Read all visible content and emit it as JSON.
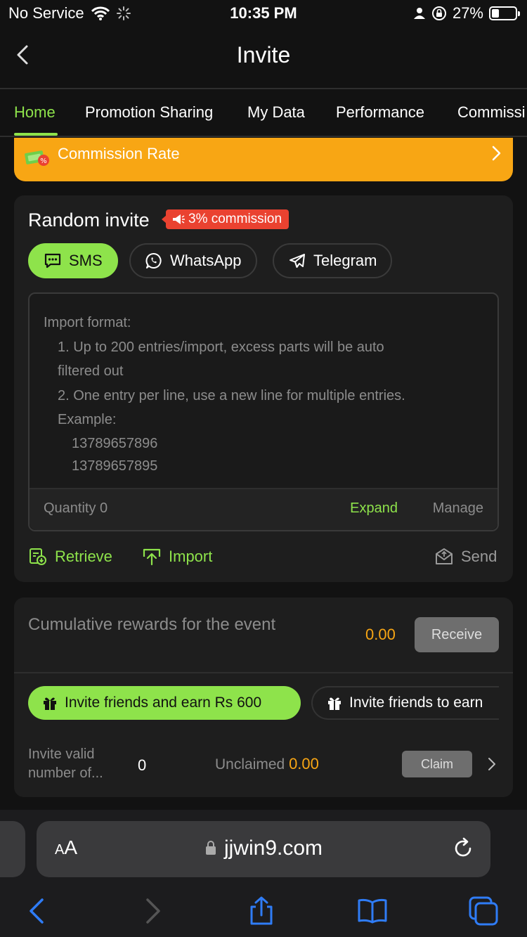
{
  "status_bar": {
    "carrier": "No Service",
    "time": "10:35 PM",
    "battery": "27%",
    "battery_level": 0.27
  },
  "header": {
    "title": "Invite"
  },
  "tabs": [
    {
      "label": "Home",
      "active": true
    },
    {
      "label": "Promotion Sharing"
    },
    {
      "label": "My Data"
    },
    {
      "label": "Performance"
    },
    {
      "label": "Commissi"
    }
  ],
  "commission_banner": {
    "label": "Commission Rate"
  },
  "invite_card": {
    "title": "Random invite",
    "badge": "3% commission",
    "channels": [
      {
        "label": "SMS",
        "icon": "sms-icon",
        "active": true
      },
      {
        "label": "WhatsApp",
        "icon": "whatsapp-icon"
      },
      {
        "label": "Telegram",
        "icon": "telegram-icon"
      }
    ],
    "import_format": {
      "heading": "Import format:",
      "line1": "1. Up to 200 entries/import, excess parts will be auto",
      "line1b": "filtered out",
      "line2": "2. One entry per line, use a new line for multiple entries.",
      "example_label": "Example:",
      "example1": "13789657896",
      "example2": "13789657895"
    },
    "quantity": "Quantity 0",
    "expand": "Expand",
    "manage": "Manage",
    "actions": {
      "retrieve": "Retrieve",
      "import": "Import",
      "send": "Send"
    }
  },
  "rewards_card": {
    "title": "Cumulative rewards for the event",
    "amount": "0.00",
    "receive": "Receive",
    "earn_tabs": [
      {
        "label": "Invite friends and earn Rs 600",
        "active": true
      },
      {
        "label": "Invite friends to earn"
      }
    ],
    "valid_label": "Invite valid number of...",
    "valid_count": "0",
    "unclaimed_label": "Unclaimed",
    "unclaimed_amount": "0.00",
    "claim": "Claim"
  },
  "browser": {
    "aa": "A",
    "aa_small": "A",
    "url": "jjwin9.com"
  },
  "colors": {
    "accent_green": "#8ee34b",
    "accent_orange": "#f8a614",
    "badge_red": "#ea4230",
    "background": "#121212",
    "card": "#1e1e1e"
  }
}
